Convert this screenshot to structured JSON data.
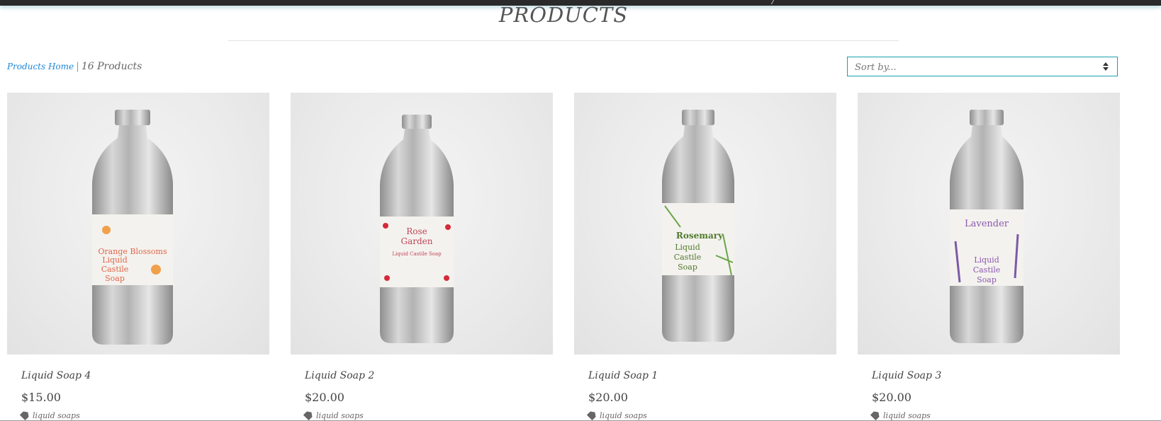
{
  "page": {
    "title": "PRODUCTS"
  },
  "breadcrumb": {
    "home": "Products Home",
    "separator": "|",
    "count": "16 Products"
  },
  "sort": {
    "value": "Sort by..."
  },
  "products": [
    {
      "name": "Liquid Soap 4",
      "price": "$15.00",
      "tag": "liquid soaps",
      "label": {
        "l1": "Orange Blossoms",
        "l2": "Liquid",
        "l3": "Castile",
        "l4": "Soap"
      },
      "label_color": "#e0674a",
      "accent": "#f0a04b"
    },
    {
      "name": "Liquid Soap 2",
      "price": "$20.00",
      "tag": "liquid soaps",
      "label": {
        "l1": "Rose",
        "l2": "Garden",
        "l3": "Liquid Castile Soap",
        "l4": ""
      },
      "label_color": "#c0455a",
      "accent": "#d42a3a"
    },
    {
      "name": "Liquid Soap 1",
      "price": "$20.00",
      "tag": "liquid soaps",
      "label": {
        "l1": "Rosemary",
        "l2": "Liquid",
        "l3": "Castile",
        "l4": "Soap"
      },
      "label_color": "#4f7a2c",
      "accent": "#6aa64a"
    },
    {
      "name": "Liquid Soap 3",
      "price": "$20.00",
      "tag": "liquid soaps",
      "label": {
        "l1": "Lavender",
        "l2": "Liquid",
        "l3": "Castile",
        "l4": "Soap"
      },
      "label_color": "#8a58b0",
      "accent": "#7b5aa6"
    }
  ],
  "colors": {
    "link": "#1e88d6",
    "sort_border": "#1aa0b0",
    "topbar": "#2a2a2a"
  },
  "icons": {
    "tag": "tag-icon",
    "sort": "sort-arrows-icon"
  }
}
